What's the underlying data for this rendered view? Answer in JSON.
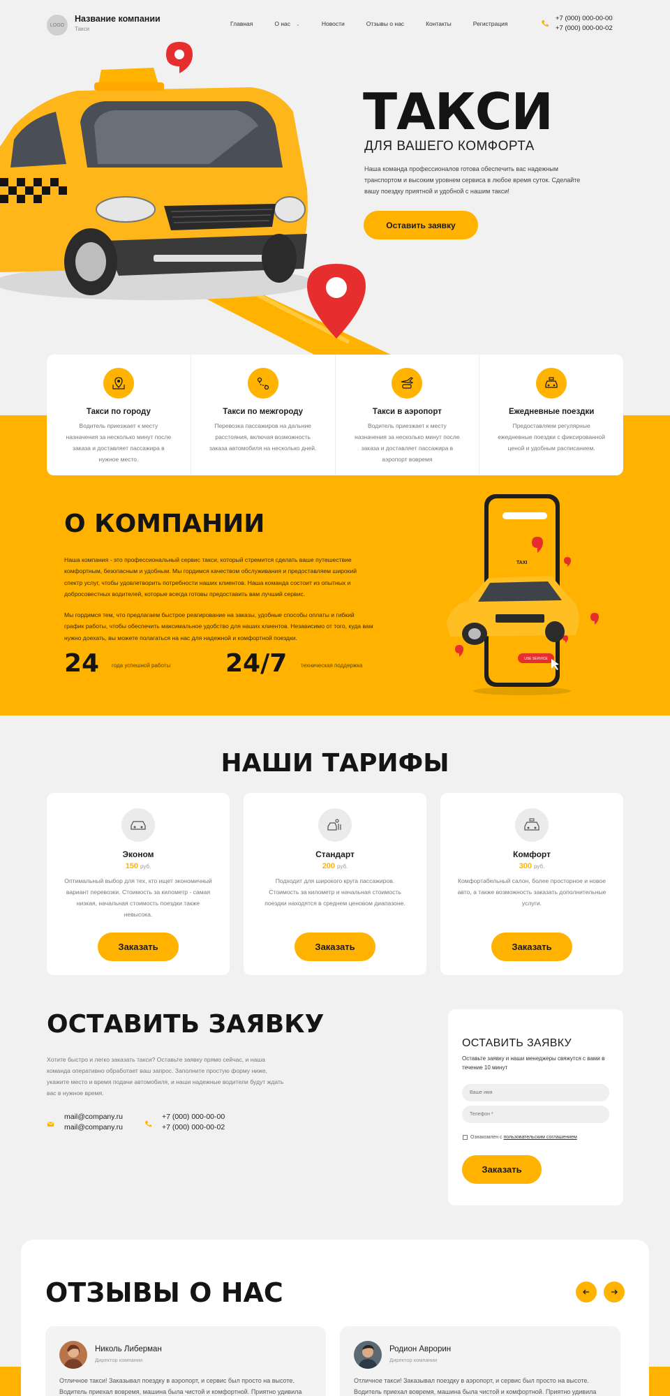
{
  "header": {
    "logo": "LOGO",
    "company_name": "Название компании",
    "company_sub": "Такси",
    "nav": [
      "Главная",
      "О нас",
      "Новости",
      "Отзывы о нас",
      "Контакты",
      "Регистрация"
    ],
    "phones": [
      "+7 (000) 000-00-00",
      "+7 (000) 000-00-02"
    ]
  },
  "hero": {
    "title": "ТАКСИ",
    "subtitle": "ДЛЯ ВАШЕГО КОМФОРТА",
    "description": "Наша команда профессионалов готова обеспечить вас надежным транспортом и высоким уровнем сервиса в любое время суток. Сделайте вашу поездку приятной и удобной с нашим такси!",
    "button": "Оставить заявку"
  },
  "services": [
    {
      "title": "Такси по городу",
      "text": "Водитель приезжает к месту назначения за несколько минут после заказа и доставляет пассажира в нужное место."
    },
    {
      "title": "Такси по межгороду",
      "text": "Перевозка пассажиров на дальние расстояния, включая возможность заказа автомобиля на несколько дней."
    },
    {
      "title": "Такси в аэропорт",
      "text": "Водитель приезжает к месту назначения за несколько минут после заказа и доставляет пассажира в аэропорт вовремя"
    },
    {
      "title": "Ежедневные поездки",
      "text": "Предоставляем регулярные ежедневные поездки с фиксированной ценой и удобным расписанием."
    }
  ],
  "about": {
    "title": "О КОМПАНИИ",
    "p1": "Наша компания - это профессиональный сервис такси, который стремится сделать ваше путешествие комфортным, безопасным и удобным. Мы гордимся качеством обслуживания и предоставляем широкий спектр услуг, чтобы удовлетворить потребности наших клиентов. Наша команда состоит из опытных и добросовестных водителей, которые всегда готовы предоставить вам лучший сервис.",
    "p2": "Мы гордимся тем, что предлагаем быстрое реагирование на заказы, удобные способы оплаты и гибкий график работы, чтобы обеспечить максимальное удобство для наших клиентов. Независимо от того, куда вам нужно доехать, вы можете полагаться на нас для надежной и комфортной поездки.",
    "stat1_num": "24",
    "stat1_label": "года успешной работы",
    "stat2_num": "24/7",
    "stat2_label": "техническая поддержка",
    "phone_taxi_label": "TAXI",
    "phone_button": "USE SERVICE"
  },
  "tariffs": {
    "title": "НАШИ ТАРИФЫ",
    "currency": "руб.",
    "button": "Заказать",
    "items": [
      {
        "name": "Эконом",
        "price": "150",
        "desc": "Оптимальный выбор для тех, кто ищет экономичный вариант перевозки. Стоимость за километр - самая низкая, начальная стоимость поездки также невысока."
      },
      {
        "name": "Стандарт",
        "price": "200",
        "desc": "Подходит для широкого круга пассажиров. Стоимость за километр и начальная стоимость поездки находятся в среднем ценовом диапазоне."
      },
      {
        "name": "Комфорт",
        "price": "300",
        "desc": "Комфортабельный салон, более просторное и новое авто, а также возможность заказать дополнительные услуги."
      }
    ]
  },
  "request": {
    "title": "ОСТАВИТЬ ЗАЯВКУ",
    "description": "Хотите быстро и легко заказать такси? Оставьте заявку прямо сейчас, и наша команда оперативно обработает ваш запрос. Заполните простую форму ниже, укажите место и время подачи автомобиля, и наши надежные водители будут ждать вас в нужное время.",
    "emails": [
      "mail@company.ru",
      "mail@company.ru"
    ],
    "phones": [
      "+7 (000) 000-00-00",
      "+7 (000) 000-00-02"
    ],
    "form": {
      "title": "ОСТАВИТЬ ЗАЯВКУ",
      "subtitle": "Оставьте заявку и наши менеджеры свяжутся с вами в течение 10 минут",
      "name_placeholder": "Ваше имя",
      "phone_placeholder": "Телефон *",
      "agree_text": "Ознакомлен с",
      "agree_link": "пользовательским соглашением",
      "button": "Заказать"
    }
  },
  "reviews": {
    "title": "ОТЗЫВЫ О НАС",
    "items": [
      {
        "name": "Николь Либерман",
        "role": "Директор компании",
        "text": "Отличное такси! Заказывал поездку в аэропорт, и сервис был просто на высоте. Водитель приехал вовремя, машина была чистой и комфортной. Приятно удивила"
      },
      {
        "name": "Родион Аврорин",
        "role": "Директор компании",
        "text": "Отличное такси! Заказывал поездку в аэропорт, и сервис был просто на высоте. Водитель приехал вовремя, машина была чистой и комфортной. Приятно удивила"
      }
    ]
  },
  "colors": {
    "accent": "#ffb300",
    "background": "#f1f1f1",
    "text": "#141414"
  }
}
